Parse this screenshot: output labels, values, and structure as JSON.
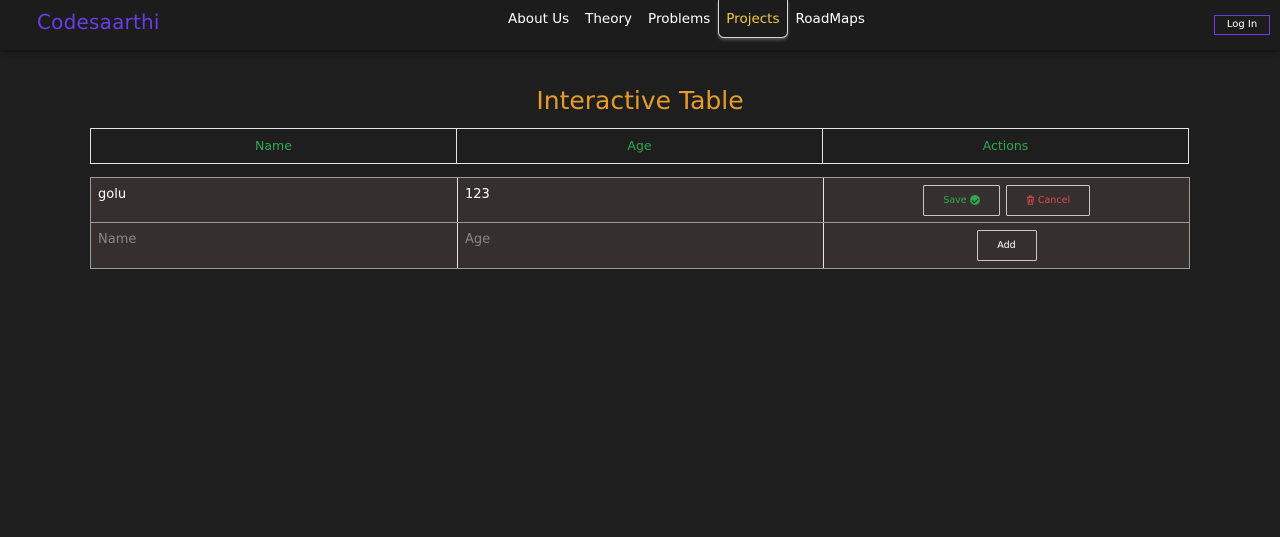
{
  "brand": "Codesaarthi",
  "nav": {
    "links": [
      {
        "label": "About Us",
        "active": false
      },
      {
        "label": "Theory",
        "active": false
      },
      {
        "label": "Problems",
        "active": false
      },
      {
        "label": "Projects",
        "active": true
      },
      {
        "label": "RoadMaps",
        "active": false
      }
    ],
    "login_label": "Log In"
  },
  "page": {
    "title": "Interactive Table"
  },
  "table": {
    "headers": [
      "Name",
      "Age",
      "Actions"
    ],
    "rows": [
      {
        "name": "golu",
        "age": "123",
        "save_label": "Save",
        "cancel_label": "Cancel"
      }
    ],
    "new_row": {
      "name_placeholder": "Name",
      "age_placeholder": "Age",
      "add_label": "Add"
    }
  },
  "colors": {
    "brand": "#6a3ce6",
    "title": "#e59a2c",
    "header_text": "#2ea84f",
    "active_nav": "#f2c84b",
    "save": "#2ea84f",
    "cancel": "#e24a4a"
  },
  "icons": {
    "save": "check-circle-icon",
    "cancel": "trash-icon"
  }
}
